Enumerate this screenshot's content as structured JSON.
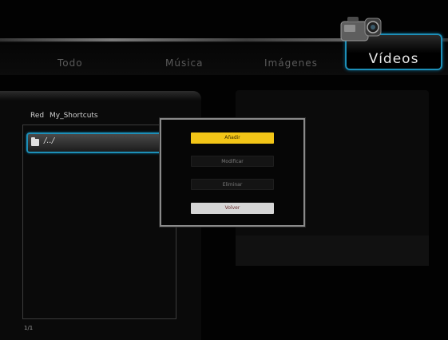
{
  "tabs": [
    {
      "label": "Todo"
    },
    {
      "label": "Música"
    },
    {
      "label": "Imágenes"
    },
    {
      "label": "Vídeos",
      "active": true
    }
  ],
  "sources": {
    "network": "Red",
    "shortcuts": "My_Shortcuts"
  },
  "list": {
    "items": [
      {
        "label": "/../",
        "icon": "folder-icon",
        "selected": true
      }
    ],
    "page_counter": "1/1"
  },
  "dialog": {
    "options": [
      {
        "label": "Añadir",
        "state": "highlighted"
      },
      {
        "label": "Modificar",
        "state": "normal"
      },
      {
        "label": "Eliminar",
        "state": "normal"
      },
      {
        "label": "Volver",
        "state": "light"
      }
    ]
  },
  "colors": {
    "accent": "#1d8fb8",
    "highlight": "#f2c517",
    "background": "#000000"
  },
  "icons": {
    "header": "video-camera-icon"
  }
}
